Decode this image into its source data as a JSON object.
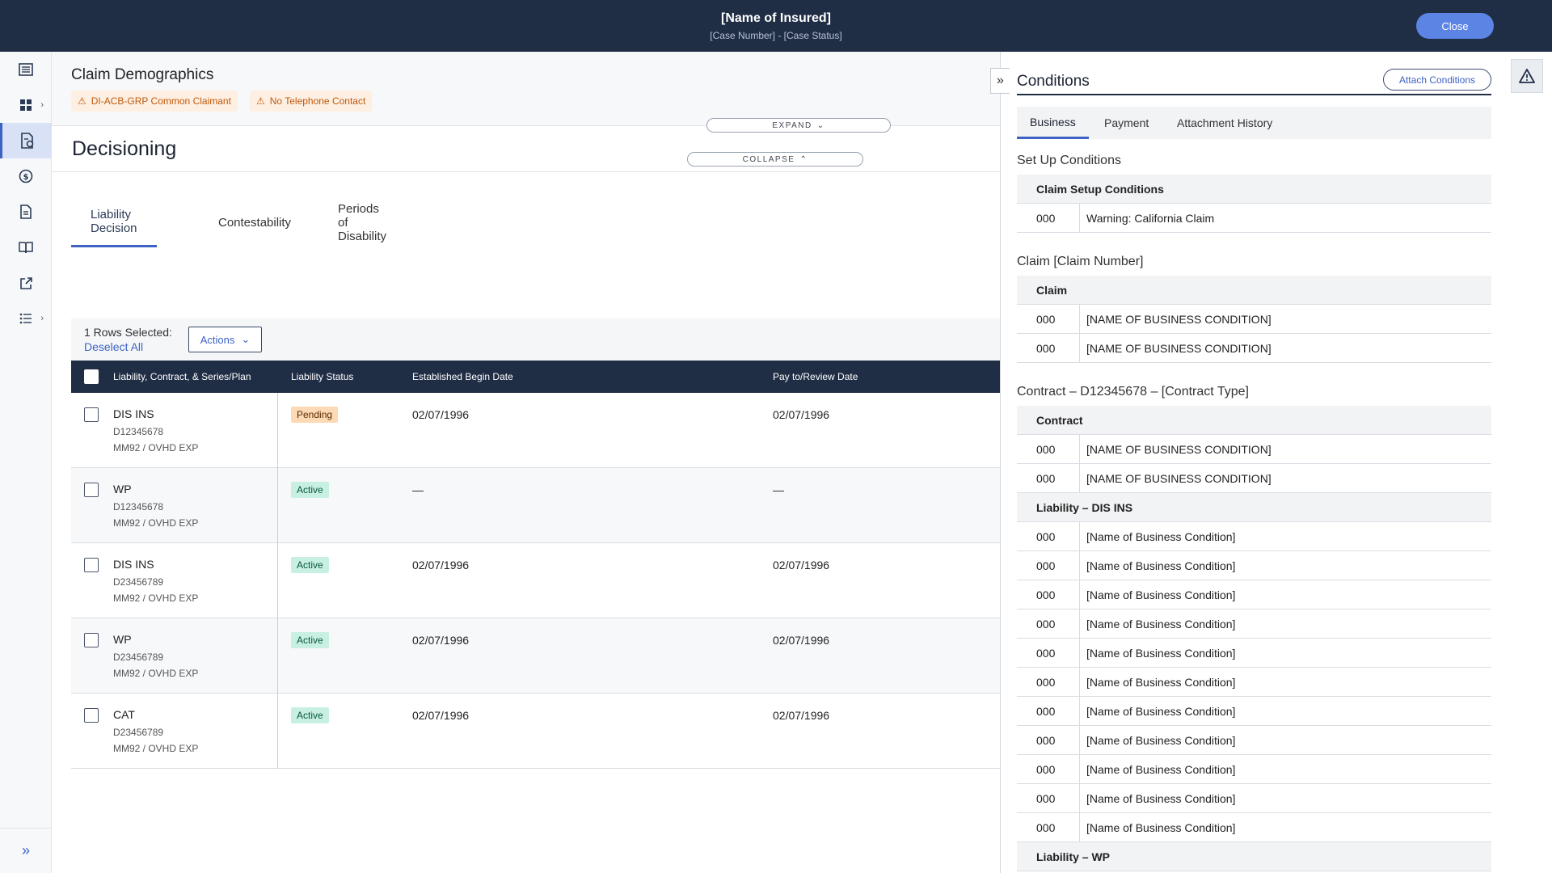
{
  "header": {
    "title": "[Name of Insured]",
    "subtitle": "[Case Number] - [Case Status]",
    "close_label": "Close"
  },
  "nav": {
    "items": [
      "list-icon",
      "grid-icon",
      "claim-doc-icon",
      "dollar-icon",
      "document-icon",
      "book-icon",
      "external-link-icon",
      "bullets-icon"
    ],
    "active": "claim-doc-icon",
    "expand_icon": "double-chevron-right-icon"
  },
  "demographics": {
    "title": "Claim Demographics",
    "badges": [
      "DI-ACB-GRP Common Claimant",
      "No Telephone Contact"
    ],
    "expand_label": "EXPAND",
    "collapse_label": "COLLAPSE"
  },
  "decisioning": {
    "title": "Decisioning",
    "tabs": [
      "Liability Decision",
      "Contestability",
      "Periods of Disability"
    ],
    "active_tab": "Liability Decision",
    "selection": {
      "count_label": "1 Rows Selected:",
      "deselect_label": "Deselect All",
      "actions_label": "Actions"
    },
    "columns": [
      "Liability, Contract, & Series/Plan",
      "Liability Status",
      "Established Begin Date",
      "Pay to/Review Date"
    ],
    "rows": [
      {
        "name": "DIS INS",
        "number": "D12345678",
        "plan": "MM92 / OVHD EXP",
        "status": "Pending",
        "begin": "02/07/1996",
        "review": "02/07/1996"
      },
      {
        "name": "WP",
        "number": "D12345678",
        "plan": "MM92 / OVHD EXP",
        "status": "Active",
        "begin": "—",
        "review": "—"
      },
      {
        "name": "DIS INS",
        "number": "D23456789",
        "plan": "MM92 / OVHD EXP",
        "status": "Active",
        "begin": "02/07/1996",
        "review": "02/07/1996"
      },
      {
        "name": "WP",
        "number": "D23456789",
        "plan": "MM92 / OVHD EXP",
        "status": "Active",
        "begin": "02/07/1996",
        "review": "02/07/1996"
      },
      {
        "name": "CAT",
        "number": "D23456789",
        "plan": "MM92 / OVHD EXP",
        "status": "Active",
        "begin": "02/07/1996",
        "review": "02/07/1996"
      }
    ]
  },
  "conditions": {
    "title": "Conditions",
    "attach_label": "Attach Conditions",
    "tabs": [
      "Business",
      "Payment",
      "Attachment History"
    ],
    "active_tab": "Business",
    "setup": {
      "heading": "Set Up Conditions",
      "group": "Claim Setup Conditions",
      "rows": [
        {
          "code": "000",
          "text": "Warning: California Claim"
        }
      ]
    },
    "claim": {
      "heading": "Claim [Claim Number]",
      "group": "Claim",
      "rows": [
        {
          "code": "000",
          "text": "[NAME OF BUSINESS CONDITION]"
        },
        {
          "code": "000",
          "text": "[NAME OF BUSINESS CONDITION]"
        }
      ]
    },
    "contract": {
      "heading": "Contract – D12345678 – [Contract Type]",
      "group": "Contract",
      "rows": [
        {
          "code": "000",
          "text": "[NAME OF BUSINESS CONDITION]"
        },
        {
          "code": "000",
          "text": "[NAME OF BUSINESS CONDITION]"
        }
      ],
      "liability_group": "Liability – DIS INS",
      "liability_rows": [
        {
          "code": "000",
          "text": "[Name of Business Condition]"
        },
        {
          "code": "000",
          "text": "[Name of Business Condition]"
        },
        {
          "code": "000",
          "text": "[Name of Business Condition]"
        },
        {
          "code": "000",
          "text": "[Name of Business Condition]"
        },
        {
          "code": "000",
          "text": "[Name of Business Condition]"
        },
        {
          "code": "000",
          "text": "[Name of Business Condition]"
        },
        {
          "code": "000",
          "text": "[Name of Business Condition]"
        },
        {
          "code": "000",
          "text": "[Name of Business Condition]"
        },
        {
          "code": "000",
          "text": "[Name of Business Condition]"
        },
        {
          "code": "000",
          "text": "[Name of Business Condition]"
        },
        {
          "code": "000",
          "text": "[Name of Business Condition]"
        }
      ],
      "wp_group": "Liability – WP"
    }
  },
  "rail": {
    "icon": "warning-icon"
  },
  "colors": {
    "header_bg": "#1f2d45",
    "accent": "#3d62c4",
    "pending": "#fdd9b5",
    "active": "#c7f0e3",
    "warning": "#c2570a"
  }
}
